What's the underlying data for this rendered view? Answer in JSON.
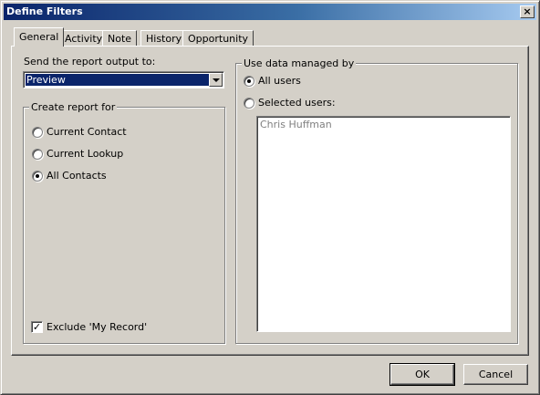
{
  "window": {
    "title": "Define Filters",
    "close_glyph": "×"
  },
  "tabs": [
    {
      "label": "General",
      "active": true
    },
    {
      "label": "Activity",
      "active": false
    },
    {
      "label": "Note",
      "active": false
    },
    {
      "label": "History",
      "active": false
    },
    {
      "label": "Opportunity",
      "active": false
    }
  ],
  "output": {
    "label": "Send the report output to:",
    "selected": "Preview"
  },
  "create_report": {
    "title": "Create report for",
    "options": [
      {
        "label": "Current Contact",
        "checked": false
      },
      {
        "label": "Current Lookup",
        "checked": false
      },
      {
        "label": "All Contacts",
        "checked": true
      }
    ]
  },
  "exclude": {
    "label": "Exclude 'My Record'",
    "checked": true,
    "glyph": "✓"
  },
  "data_managed": {
    "title": "Use data managed by",
    "options": [
      {
        "label": "All users",
        "checked": true
      },
      {
        "label": "Selected users:",
        "checked": false
      }
    ],
    "users": [
      "Chris Huffman"
    ]
  },
  "buttons": {
    "ok": "OK",
    "cancel": "Cancel"
  }
}
